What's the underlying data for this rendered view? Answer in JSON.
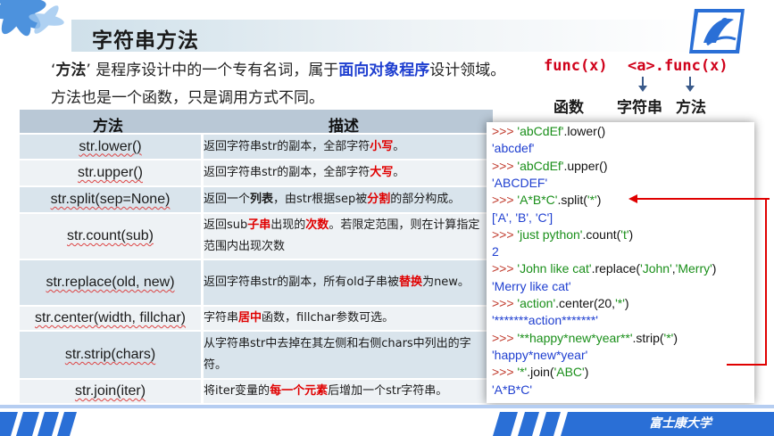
{
  "slide_title": "字符串方法",
  "intro": {
    "line1_prefix": "‘",
    "line1_term": "方法",
    "line1_mid": "’ 是程序设计中的一个专有名词，属于",
    "line1_highlight": "面向对象程序",
    "line1_suffix": "设计领域。",
    "line2": "方法也是一个函数，只是调用方式不同。"
  },
  "syntax": {
    "func_call": "func(x)",
    "method_call": "<a>.func(x)",
    "label_function": "函数",
    "label_string": "字符串",
    "label_method": "方法"
  },
  "table": {
    "headers": [
      "方法",
      "描述"
    ],
    "rows": [
      {
        "method": "str.lower()",
        "desc": [
          [
            "返回字符串str的副本，全部字符",
            ""
          ],
          [
            "小写",
            "red"
          ],
          [
            "。",
            ""
          ]
        ]
      },
      {
        "method": "str.upper()",
        "desc": [
          [
            "返回字符串str的副本，全部字符",
            ""
          ],
          [
            "大写",
            "red"
          ],
          [
            "。",
            ""
          ]
        ]
      },
      {
        "method": "str.split(sep=None)",
        "desc": [
          [
            "返回一个",
            ""
          ],
          [
            "列表",
            "bold"
          ],
          [
            "，由str根据sep被",
            ""
          ],
          [
            "分割",
            "red"
          ],
          [
            "的部分构成。",
            ""
          ]
        ]
      },
      {
        "method": "str.count(sub)",
        "desc": [
          [
            "返回sub",
            ""
          ],
          [
            "子串",
            "red"
          ],
          [
            "出现的",
            ""
          ],
          [
            "次数",
            "red"
          ],
          [
            "。若限定范围，则在计算指定范围内出现次数",
            ""
          ]
        ]
      },
      {
        "method": "str.replace(old, new)",
        "desc": [
          [
            "返回字符串str的副本，所有old子串被",
            ""
          ],
          [
            "替换",
            "red"
          ],
          [
            "为new。",
            ""
          ]
        ]
      },
      {
        "method": "str.center(width, fillchar)",
        "desc": [
          [
            "字符串",
            ""
          ],
          [
            "居中",
            "red"
          ],
          [
            "函数，fillchar参数可选。",
            ""
          ]
        ]
      },
      {
        "method": "str.strip(chars)",
        "desc": [
          [
            "从字符串str中去掉在其左侧和右侧chars中列出的字符。",
            ""
          ]
        ]
      },
      {
        "method": "str.join(iter)",
        "desc": [
          [
            "将iter变量的",
            ""
          ],
          [
            "每一个元素",
            "red"
          ],
          [
            "后增加一个str字符串。",
            ""
          ]
        ]
      }
    ]
  },
  "code": {
    "prompt": ">>> ",
    "lines": [
      {
        "kind": "in",
        "parts": [
          [
            "'abCdEf'",
            "str"
          ],
          [
            ".lower()",
            "blk"
          ]
        ]
      },
      {
        "kind": "out",
        "parts": [
          [
            "'abcdef'",
            "out"
          ]
        ]
      },
      {
        "kind": "in",
        "parts": [
          [
            "'abCdEf'",
            "str"
          ],
          [
            ".upper()",
            "blk"
          ]
        ]
      },
      {
        "kind": "out",
        "parts": [
          [
            "'ABCDEF'",
            "out"
          ]
        ]
      },
      {
        "kind": "in",
        "parts": [
          [
            "'A*B*C'",
            "str"
          ],
          [
            ".split(",
            "blk"
          ],
          [
            "'*'",
            "str"
          ],
          [
            ")",
            "blk"
          ]
        ]
      },
      {
        "kind": "out",
        "parts": [
          [
            "['A', 'B', 'C']",
            "out"
          ]
        ]
      },
      {
        "kind": "in",
        "parts": [
          [
            "'just python'",
            "str"
          ],
          [
            ".count(",
            "blk"
          ],
          [
            "'t'",
            "str"
          ],
          [
            ")",
            "blk"
          ]
        ]
      },
      {
        "kind": "out",
        "parts": [
          [
            "2",
            "out"
          ]
        ]
      },
      {
        "kind": "in",
        "parts": [
          [
            "'John like cat'",
            "str"
          ],
          [
            ".replace(",
            "blk"
          ],
          [
            "'John'",
            "str"
          ],
          [
            ",",
            "blk"
          ],
          [
            "'Merry'",
            "str"
          ],
          [
            ")",
            "blk"
          ]
        ]
      },
      {
        "kind": "out",
        "parts": [
          [
            "'Merry like cat'",
            "out"
          ]
        ]
      },
      {
        "kind": "in",
        "parts": [
          [
            "'action'",
            "str"
          ],
          [
            ".center(20,",
            "blk"
          ],
          [
            "'*'",
            "str"
          ],
          [
            ")",
            "blk"
          ]
        ]
      },
      {
        "kind": "out",
        "parts": [
          [
            "'*******action*******'",
            "out"
          ]
        ]
      },
      {
        "kind": "in",
        "parts": [
          [
            "'**happy*new*year**'",
            "str"
          ],
          [
            ".strip(",
            "blk"
          ],
          [
            "'*'",
            "str"
          ],
          [
            ")",
            "blk"
          ]
        ]
      },
      {
        "kind": "out",
        "parts": [
          [
            "'happy*new*year'",
            "out"
          ]
        ]
      },
      {
        "kind": "in",
        "parts": [
          [
            "'*'",
            "str"
          ],
          [
            ".join(",
            "blk"
          ],
          [
            "'ABC'",
            "str"
          ],
          [
            ")",
            "blk"
          ]
        ]
      },
      {
        "kind": "out",
        "parts": [
          [
            "'A*B*C'",
            "out"
          ]
        ]
      }
    ]
  },
  "footer": "富士康大学",
  "colors": {
    "accent_blue": "#1f3fd0",
    "accent_red": "#e00000",
    "table_header": "#b9c8d6",
    "table_row": "#d9e4ec",
    "footer_band": "#2a6fd6"
  }
}
